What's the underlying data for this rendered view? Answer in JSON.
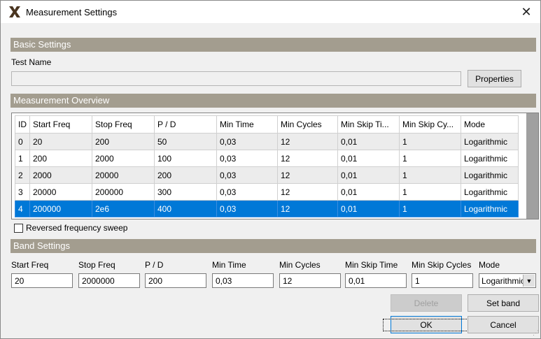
{
  "window": {
    "title": "Measurement Settings"
  },
  "sections": {
    "basic": "Basic Settings",
    "overview": "Measurement Overview",
    "band": "Band Settings"
  },
  "basic": {
    "test_name_label": "Test Name",
    "test_name_value": "",
    "properties_label": "Properties"
  },
  "table": {
    "columns": [
      "ID",
      "Start Freq",
      "Stop Freq",
      "P / D",
      "Min Time",
      "Min Cycles",
      "Min Skip Ti...",
      "Min Skip Cy...",
      "Mode"
    ],
    "rows": [
      [
        "0",
        "20",
        "200",
        "50",
        "0,03",
        "12",
        "0,01",
        "1",
        "Logarithmic"
      ],
      [
        "1",
        "200",
        "2000",
        "100",
        "0,03",
        "12",
        "0,01",
        "1",
        "Logarithmic"
      ],
      [
        "2",
        "2000",
        "20000",
        "200",
        "0,03",
        "12",
        "0,01",
        "1",
        "Logarithmic"
      ],
      [
        "3",
        "20000",
        "200000",
        "300",
        "0,03",
        "12",
        "0,01",
        "1",
        "Logarithmic"
      ],
      [
        "4",
        "200000",
        "2e6",
        "400",
        "0,03",
        "12",
        "0,01",
        "1",
        "Logarithmic"
      ]
    ],
    "selected_row": 4
  },
  "reversed_sweep": {
    "label": "Reversed frequency sweep",
    "checked": false
  },
  "band": {
    "start_freq": {
      "label": "Start Freq",
      "value": "20"
    },
    "stop_freq": {
      "label": "Stop Freq",
      "value": "2000000"
    },
    "pd": {
      "label": "P / D",
      "value": "200"
    },
    "min_time": {
      "label": "Min Time",
      "value": "0,03"
    },
    "min_cycles": {
      "label": "Min Cycles",
      "value": "12"
    },
    "min_skip_time": {
      "label": "Min Skip Time",
      "value": "0,01"
    },
    "min_skip_cycles": {
      "label": "Min Skip Cycles",
      "value": "1"
    },
    "mode": {
      "label": "Mode",
      "value": "Logarithmic"
    }
  },
  "buttons": {
    "delete": "Delete",
    "set_band": "Set band",
    "ok": "OK",
    "cancel": "Cancel"
  },
  "icons": {
    "app": "app-x-logo-icon",
    "close": "close-icon",
    "dropdown": "chevron-down-icon"
  },
  "colors": {
    "section_header": "#a39d8f",
    "selection": "#0078d7",
    "logo": "#4a3520"
  }
}
